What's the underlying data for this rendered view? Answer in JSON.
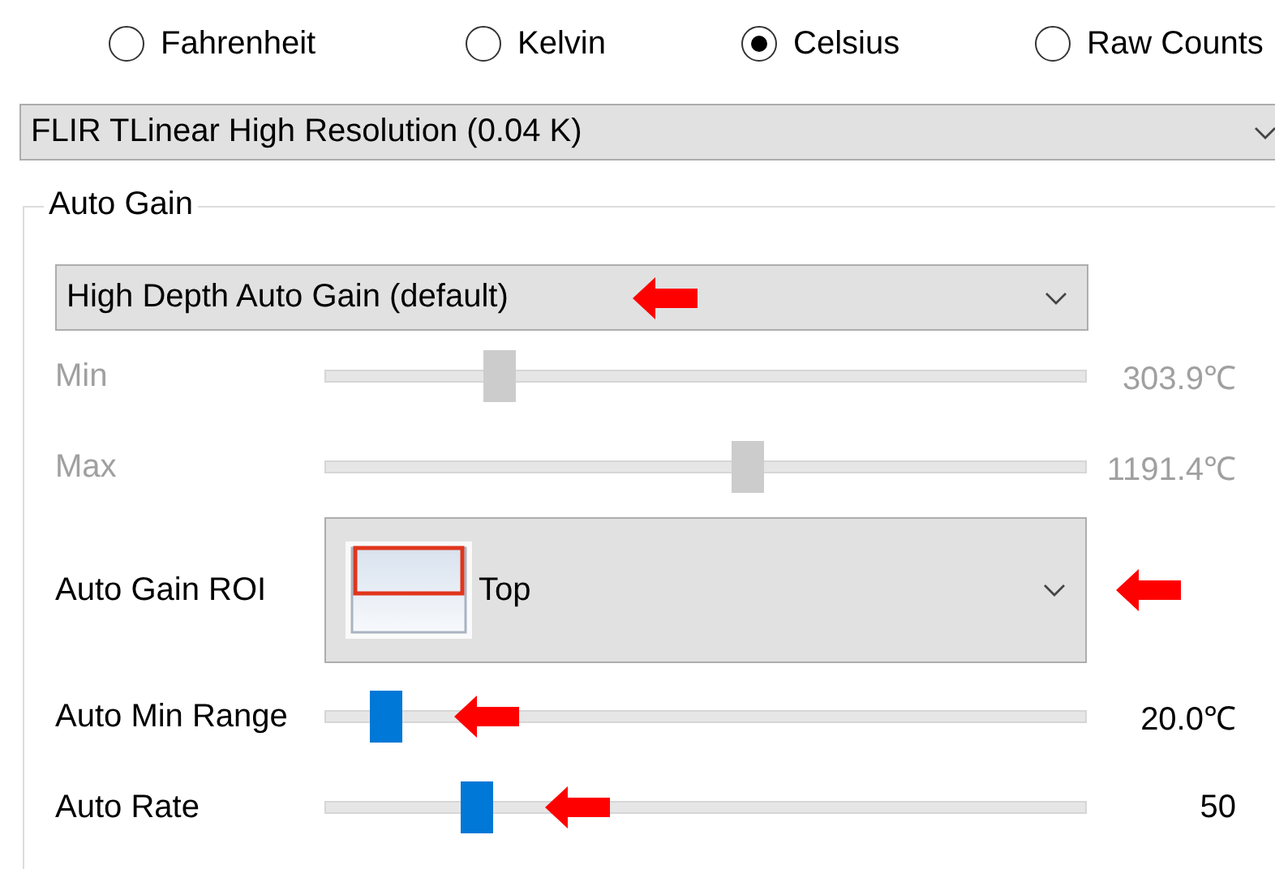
{
  "units": [
    {
      "label": "Fahrenheit",
      "selected": false
    },
    {
      "label": "Kelvin",
      "selected": false
    },
    {
      "label": "Celsius",
      "selected": true
    },
    {
      "label": "Raw Counts",
      "selected": false
    }
  ],
  "resolution": {
    "value": "FLIR TLinear High Resolution (0.04 K)"
  },
  "auto_gain": {
    "title": "Auto Gain",
    "mode": {
      "value": "High Depth Auto Gain (default)",
      "callout": true
    },
    "controls": [
      {
        "kind": "slider",
        "label": "Min",
        "level": 0.23,
        "reading": "303.9℃",
        "disabled": true,
        "callout": false
      },
      {
        "kind": "slider",
        "label": "Max",
        "level": 0.555,
        "reading": "1191.4℃",
        "disabled": true,
        "callout": false
      },
      {
        "kind": "roi",
        "label": "Auto Gain ROI",
        "value": "Top",
        "callout": true
      },
      {
        "kind": "slider",
        "label": "Auto Min Range",
        "level": 0.08,
        "reading": "20.0℃",
        "disabled": false,
        "callout": true
      },
      {
        "kind": "slider",
        "label": "Auto Rate",
        "level": 0.2,
        "reading": "50",
        "disabled": false,
        "callout": true
      }
    ]
  }
}
